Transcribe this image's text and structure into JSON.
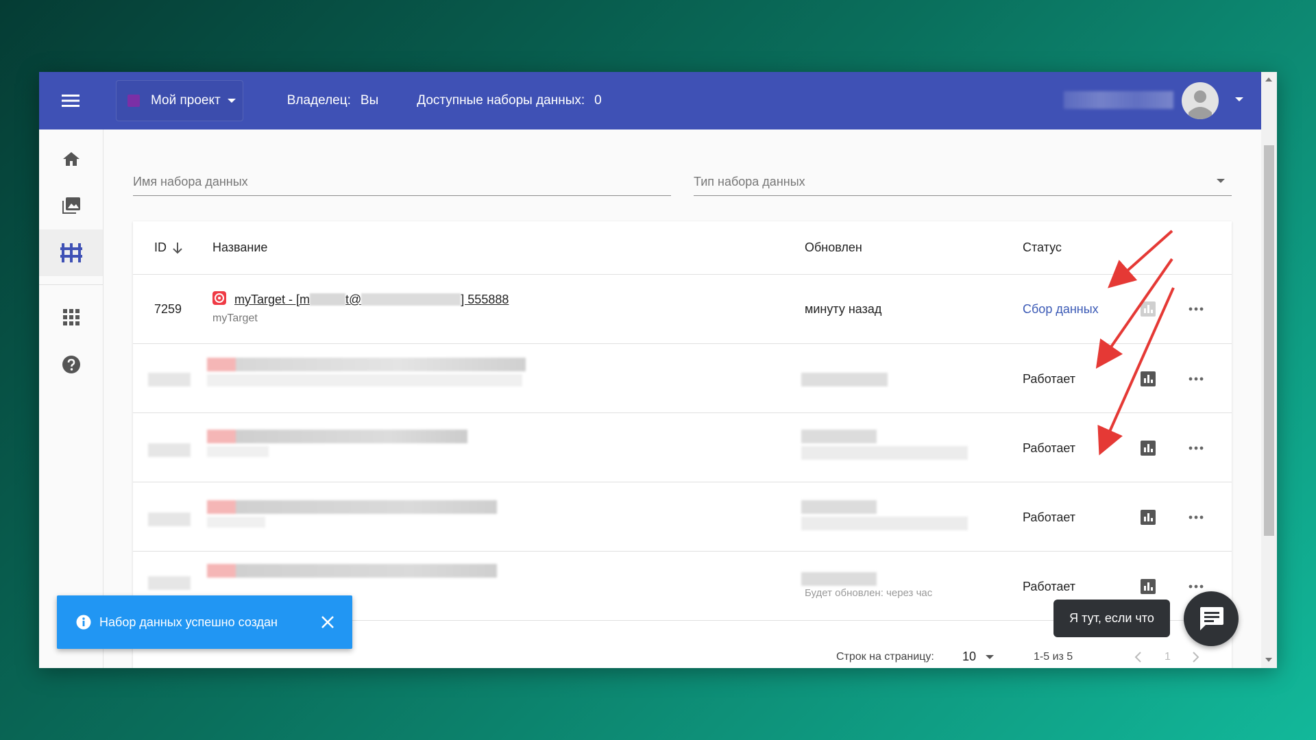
{
  "header": {
    "project_label": "Мой проект",
    "project_color": "#7b2fa6",
    "owner_label": "Владелец:",
    "owner_value": "Вы",
    "available_label": "Доступные наборы данных:",
    "available_value": "0"
  },
  "sidebar": {
    "items": [
      {
        "icon": "home-icon"
      },
      {
        "icon": "gallery-icon"
      },
      {
        "icon": "datasets-icon",
        "active": true
      },
      {
        "icon": "apps-grid-icon"
      },
      {
        "icon": "help-icon"
      }
    ]
  },
  "filters": {
    "name_placeholder": "Имя набора данных",
    "type_placeholder": "Тип набора данных"
  },
  "table": {
    "headers": {
      "id": "ID",
      "name": "Название",
      "updated": "Обновлен",
      "status": "Статус"
    },
    "rows": [
      {
        "id": "7259",
        "name_part1": "myTarget - [m",
        "name_part2": "t@",
        "name_part3": "] 555888",
        "source": "myTarget",
        "updated": "минуту назад",
        "status": "Сбор данных"
      },
      {
        "status": "Работает"
      },
      {
        "status": "Работает"
      },
      {
        "status": "Работает"
      },
      {
        "status": "Работает",
        "updated_partial": "Будет обновлен: через час"
      }
    ]
  },
  "pagination": {
    "rows_label": "Строк на страницу:",
    "rows_value": "10",
    "range": "1-5 из 5",
    "page": "1"
  },
  "snackbar": {
    "text": "Набор данных успешно создан"
  },
  "chat": {
    "tooltip": "Я тут, если что"
  },
  "colors": {
    "primary": "#3f51b5",
    "snackbar": "#2196f3",
    "arrow": "#e53935",
    "link": "#3a59b5"
  }
}
